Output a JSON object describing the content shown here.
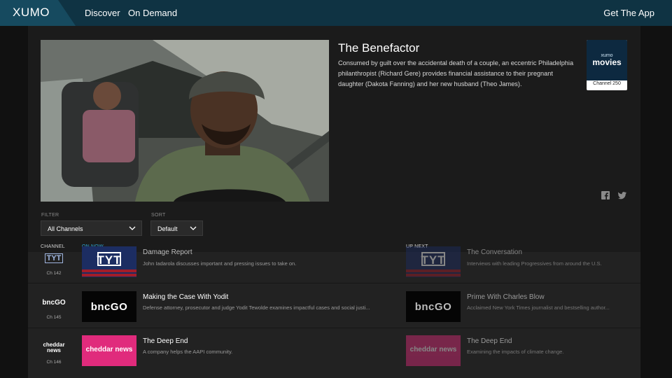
{
  "nav": {
    "logo": "XUMO",
    "discover": "Discover",
    "on_demand": "On Demand",
    "get_app": "Get The App"
  },
  "program": {
    "title": "The Benefactor",
    "description": "Consumed by guilt over the accidental death of a couple, an eccentric Philadelphia philanthropist (Richard Gere) provides financial assistance to their pregnant daughter (Dakota Fanning) and her new husband (Theo James)."
  },
  "channel_card": {
    "brand_top": "xumo",
    "brand_main": "movies",
    "number": "Channel 250"
  },
  "share": {
    "facebook_icon": "facebook-icon",
    "twitter_icon": "twitter-icon"
  },
  "filter": {
    "filter_label": "FILTER",
    "filter_value": "All Channels",
    "sort_label": "SORT",
    "sort_value": "Default"
  },
  "schedule": {
    "headers": {
      "channel": "CHANNEL",
      "on_now": "ON NOW",
      "up_next": "UP NEXT"
    },
    "rows": [
      {
        "channel_logo": "TYT",
        "channel_number": "Ch 142",
        "now_thumb": "TYT",
        "now_title": "Damage Report",
        "now_desc": "John Iadarola discusses important and pressing issues to take on.",
        "next_thumb": "TYT",
        "next_title": "The Conversation",
        "next_desc": "Interviews with leading Progressives from around the U.S."
      },
      {
        "channel_logo": "bncGO",
        "channel_number": "Ch 145",
        "now_thumb": "bncGO",
        "now_title": "Making the Case With Yodit",
        "now_desc": "Defense attorney, prosecutor and judge Yodit Tewolde examines impactful cases and social justi...",
        "next_thumb": "bncGO",
        "next_title": "Prime With Charles Blow",
        "next_desc": "Acclaimed New York Times journalist and bestselling author..."
      },
      {
        "channel_logo": "cheddar news",
        "channel_number": "Ch 146",
        "now_thumb": "cheddar news",
        "now_title": "The Deep End",
        "now_desc": "A company helps the AAPI community.",
        "next_thumb": "cheddar news",
        "next_title": "The Deep End",
        "next_desc": "Examining the impacts of climate change."
      }
    ]
  }
}
